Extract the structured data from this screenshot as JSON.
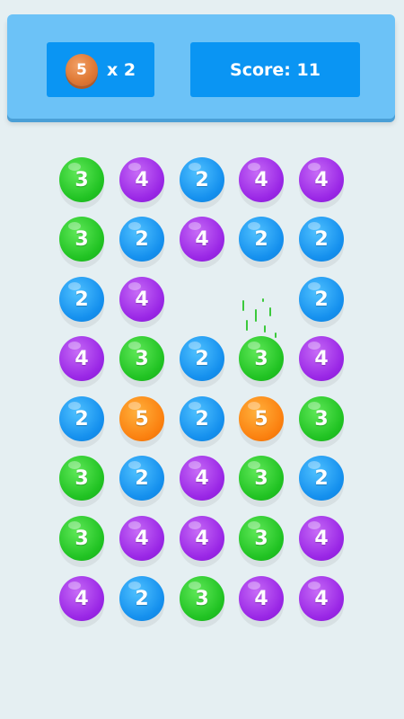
{
  "header": {
    "goal_value": "5",
    "goal_multiplier": "x 2",
    "score_text": "Score: 11"
  },
  "board": {
    "rows": [
      [
        3,
        4,
        2,
        4,
        4
      ],
      [
        3,
        2,
        4,
        2,
        2
      ],
      [
        2,
        4,
        null,
        null,
        2
      ],
      [
        4,
        3,
        2,
        3,
        4
      ],
      [
        2,
        5,
        2,
        5,
        3
      ],
      [
        3,
        2,
        4,
        3,
        2
      ],
      [
        3,
        4,
        4,
        3,
        4
      ],
      [
        4,
        2,
        3,
        4,
        4
      ]
    ]
  },
  "colors": {
    "2": "#1590ee",
    "3": "#21c323",
    "4": "#9a27e6",
    "5": "#fb8110",
    "header_bg": "#6cc2f7",
    "pill_bg": "#0a95f3",
    "page_bg": "#e5eff2"
  }
}
